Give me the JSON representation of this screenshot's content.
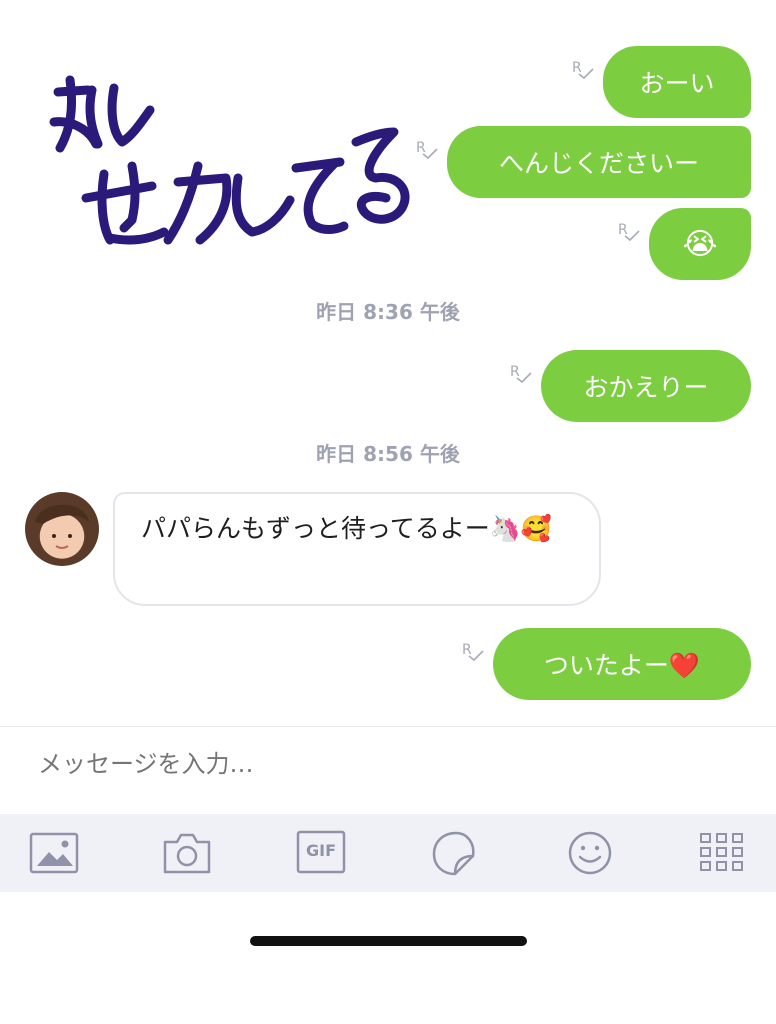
{
  "messages_out_1": [
    "おーい",
    "へんじくださいー",
    "😭"
  ],
  "read_mark": "R",
  "timestamps": [
    "昨日 8:36 午後",
    "昨日 8:56 午後"
  ],
  "message_out_2": "おかえりー",
  "message_in": "パパらんもずっと待ってるよー🦄🥰",
  "message_out_3": "ついたよー❤️",
  "composer": {
    "placeholder": "メッセージを入力…"
  },
  "toolbar": {
    "gif_label": "GIF"
  },
  "icons": [
    "photo-icon",
    "camera-icon",
    "gif-icon",
    "sticker-icon",
    "emoji-icon",
    "more-grid-icon"
  ],
  "colors": {
    "outgoing_bubble": "#7ccd3f",
    "ink": "#2b1a7a",
    "timestamp": "#9fa2b2"
  }
}
